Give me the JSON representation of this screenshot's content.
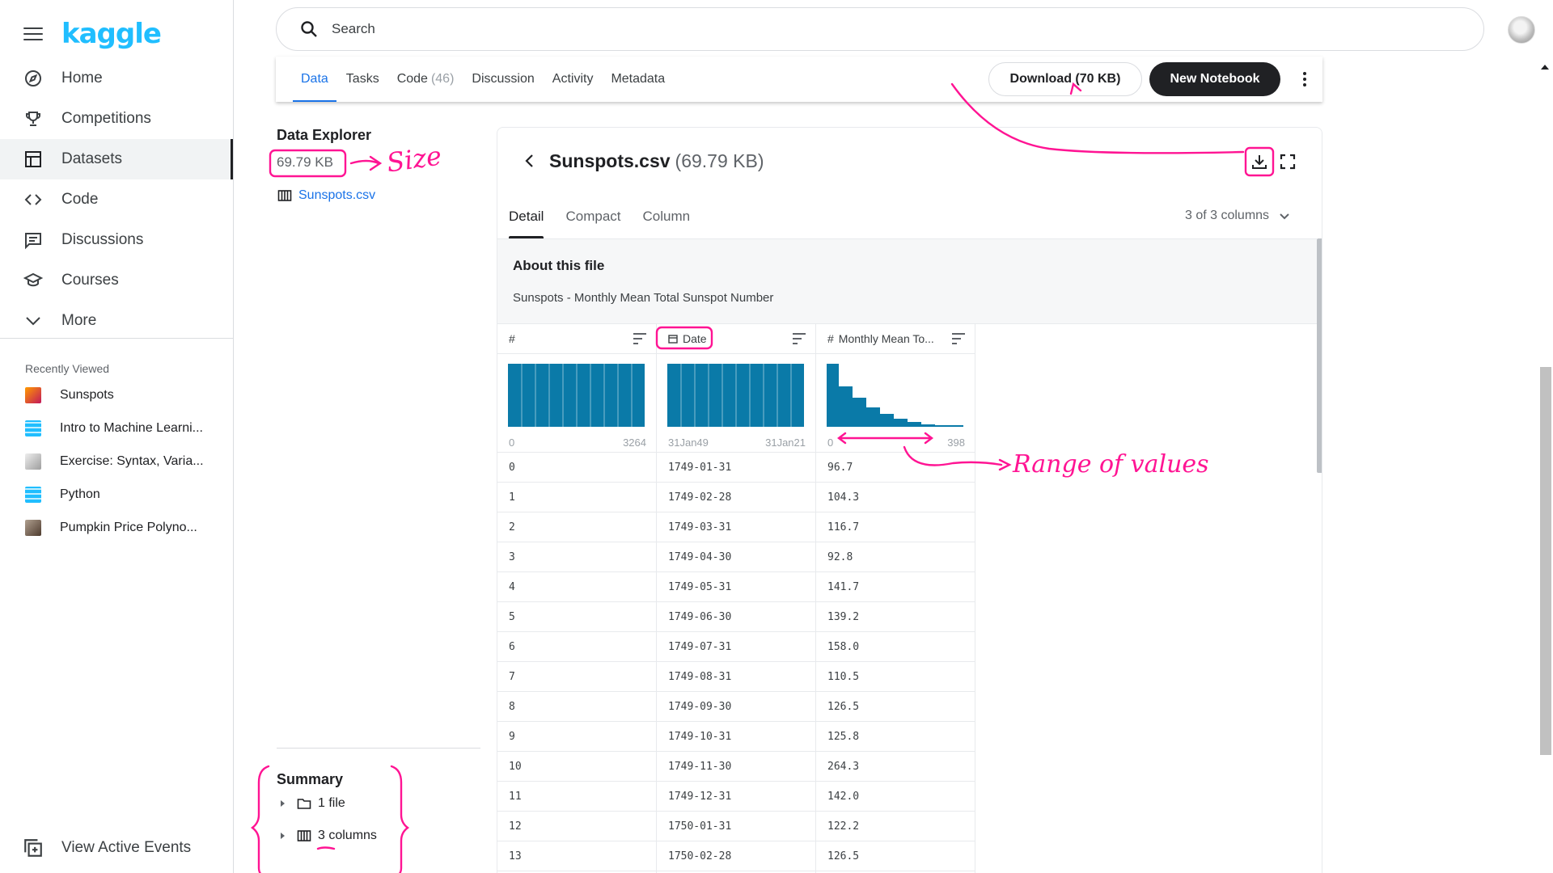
{
  "app": {
    "logo": "kaggle"
  },
  "sidebar": {
    "items": [
      {
        "label": "Home",
        "icon": "compass-icon"
      },
      {
        "label": "Competitions",
        "icon": "trophy-icon"
      },
      {
        "label": "Datasets",
        "icon": "table-icon",
        "active": true
      },
      {
        "label": "Code",
        "icon": "code-icon"
      },
      {
        "label": "Discussions",
        "icon": "comment-icon"
      },
      {
        "label": "Courses",
        "icon": "school-icon"
      },
      {
        "label": "More",
        "icon": "chevron-down-icon"
      }
    ],
    "recent_title": "Recently Viewed",
    "recent": [
      {
        "label": "Sunspots",
        "color": "#e8541a"
      },
      {
        "label": "Intro to Machine Learni...",
        "color": "#20beff"
      },
      {
        "label": "Exercise: Syntax, Varia...",
        "color": "#9e9e9e"
      },
      {
        "label": "Python",
        "color": "#20beff"
      },
      {
        "label": "Pumpkin Price Polyno...",
        "color": "#6d5a4a"
      }
    ],
    "view_events": "View Active Events"
  },
  "search": {
    "placeholder": "Search"
  },
  "tabs": [
    {
      "label": "Data",
      "active": true
    },
    {
      "label": "Tasks"
    },
    {
      "label": "Code",
      "count": "(46)"
    },
    {
      "label": "Discussion"
    },
    {
      "label": "Activity"
    },
    {
      "label": "Metadata"
    }
  ],
  "buttons": {
    "download": "Download (70 KB)",
    "new_notebook": "New Notebook"
  },
  "explorer": {
    "title": "Data Explorer",
    "size": "69.79 KB",
    "file": "Sunspots.csv",
    "summary_title": "Summary",
    "summary_files": "1 file",
    "summary_columns": "3 columns"
  },
  "preview": {
    "filename": "Sunspots.csv",
    "size": "(69.79 KB)",
    "view_tabs": [
      "Detail",
      "Compact",
      "Column"
    ],
    "columns_selector": "3 of 3 columns",
    "about_title": "About this file",
    "about_text": "Sunspots - Monthly Mean Total Sunspot Number",
    "columns": [
      {
        "name": "#",
        "type_icon": "",
        "hist_lo": "0",
        "hist_hi": "3264"
      },
      {
        "name": "Date",
        "type_icon": "calendar-icon",
        "hist_lo": "31Jan49",
        "hist_hi": "31Jan21"
      },
      {
        "name": "Monthly Mean To...",
        "type_icon": "#",
        "hist_lo": "0",
        "hist_hi": "398"
      }
    ],
    "rows": [
      [
        "0",
        "1749-01-31",
        "96.7"
      ],
      [
        "1",
        "1749-02-28",
        "104.3"
      ],
      [
        "2",
        "1749-03-31",
        "116.7"
      ],
      [
        "3",
        "1749-04-30",
        "92.8"
      ],
      [
        "4",
        "1749-05-31",
        "141.7"
      ],
      [
        "5",
        "1749-06-30",
        "139.2"
      ],
      [
        "6",
        "1749-07-31",
        "158.0"
      ],
      [
        "7",
        "1749-08-31",
        "110.5"
      ],
      [
        "8",
        "1749-09-30",
        "126.5"
      ],
      [
        "9",
        "1749-10-31",
        "125.8"
      ],
      [
        "10",
        "1749-11-30",
        "264.3"
      ],
      [
        "11",
        "1749-12-31",
        "142.0"
      ],
      [
        "12",
        "1750-01-31",
        "122.2"
      ],
      [
        "13",
        "1750-02-28",
        "126.5"
      ]
    ]
  },
  "annotations": {
    "size_note": "Size",
    "range_note": "Range of values",
    "color": "#ff1493"
  }
}
